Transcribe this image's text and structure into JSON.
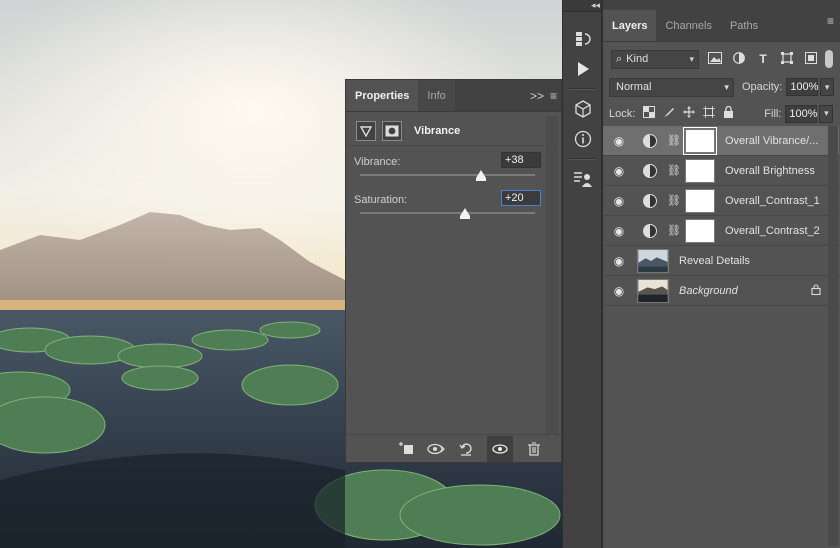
{
  "properties": {
    "tabs": [
      {
        "label": "Properties"
      },
      {
        "label": "Info"
      }
    ],
    "menu_glyph": "≡",
    "expand_glyph": ">>",
    "title": "Vibrance",
    "vibrance": {
      "label": "Vibrance:",
      "value": "+38",
      "level": 0.69
    },
    "saturation": {
      "label": "Saturation:",
      "value": "+20",
      "level": 0.6
    }
  },
  "layers": {
    "tabs": [
      {
        "label": "Layers"
      },
      {
        "label": "Channels"
      },
      {
        "label": "Paths"
      }
    ],
    "kind_label": "Kind",
    "blend_mode": "Normal",
    "opacity_label": "Opacity:",
    "opacity_value": "100%",
    "lock_label": "Lock:",
    "fill_label": "Fill:",
    "fill_value": "100%",
    "items": [
      {
        "name": "Overall Vibrance/...",
        "type": "adjustment",
        "selected": true
      },
      {
        "name": "Overall Brightness",
        "type": "adjustment",
        "selected": false
      },
      {
        "name": "Overall_Contrast_1",
        "type": "adjustment",
        "selected": false
      },
      {
        "name": "Overall_Contrast_2",
        "type": "adjustment",
        "selected": false
      },
      {
        "name": "Reveal Details",
        "type": "photo",
        "selected": false
      },
      {
        "name": "Background",
        "type": "photo",
        "selected": false,
        "italic": true,
        "locked": true
      }
    ]
  },
  "icons": {
    "eye": "eye-icon",
    "link": "link-icon",
    "lock": "lock-icon"
  },
  "colors": {
    "panel_bg": "#535353",
    "dark_bg": "#424242",
    "focus_blue": "#4a7fd4"
  }
}
